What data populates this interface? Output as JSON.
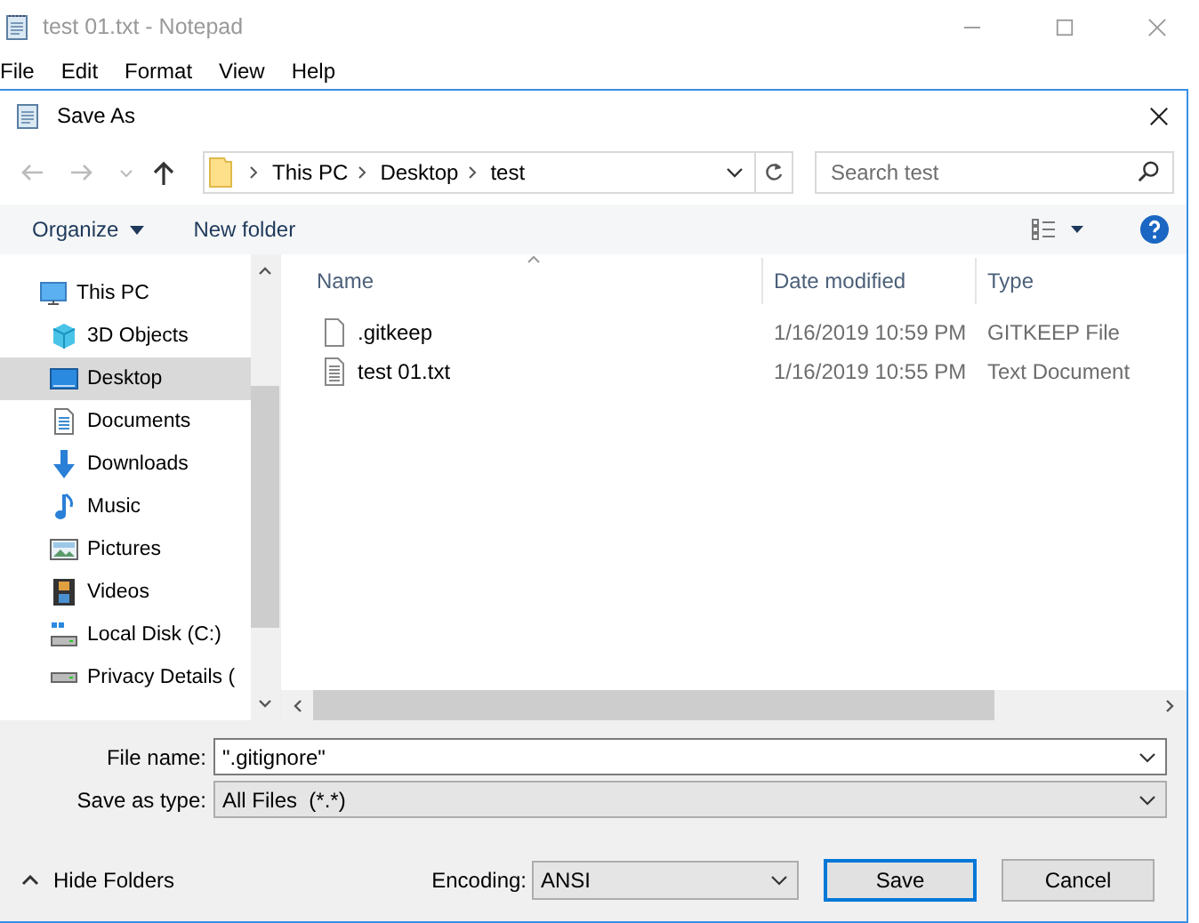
{
  "notepad": {
    "title": "test 01.txt - Notepad",
    "menu": [
      "File",
      "Edit",
      "Format",
      "View",
      "Help"
    ]
  },
  "dialog": {
    "title": "Save As",
    "breadcrumb": [
      "This PC",
      "Desktop",
      "test"
    ],
    "search": {
      "placeholder": "Search test"
    },
    "toolbar": [
      "Organize",
      "New folder"
    ],
    "nav": [
      {
        "label": "This PC",
        "kind": "pc",
        "selected": false,
        "children": [
          {
            "label": "3D Objects",
            "kind": "cube",
            "selected": false
          },
          {
            "label": "Desktop",
            "kind": "desktop",
            "selected": true
          },
          {
            "label": "Documents",
            "kind": "document",
            "selected": false
          },
          {
            "label": "Downloads",
            "kind": "download",
            "selected": false
          },
          {
            "label": "Music",
            "kind": "music",
            "selected": false
          },
          {
            "label": "Pictures",
            "kind": "pictures",
            "selected": false
          },
          {
            "label": "Videos",
            "kind": "video",
            "selected": false
          },
          {
            "label": "Local Disk (C:)",
            "kind": "disk",
            "selected": false
          },
          {
            "label": "Privacy Details (",
            "kind": "drive",
            "selected": false
          }
        ]
      }
    ],
    "columns": [
      "Name",
      "Date modified",
      "Type"
    ],
    "files": [
      {
        "name": ".gitkeep",
        "date": "1/16/2019 10:59 PM",
        "type": "GITKEEP File",
        "kind": "blank"
      },
      {
        "name": "test 01.txt",
        "date": "1/16/2019 10:55 PM",
        "type": "Text Document",
        "kind": "text"
      }
    ],
    "file_name": {
      "label": "File name:",
      "value": "\".gitignore\""
    },
    "save_as_type": {
      "label": "Save as type:",
      "value": "All Files  (*.*)"
    },
    "hide_folders": "Hide Folders",
    "encoding": {
      "label": "Encoding:",
      "value": "ANSI"
    },
    "buttons": [
      {
        "label": "Save",
        "default": true
      },
      {
        "label": "Cancel",
        "default": false
      }
    ]
  }
}
